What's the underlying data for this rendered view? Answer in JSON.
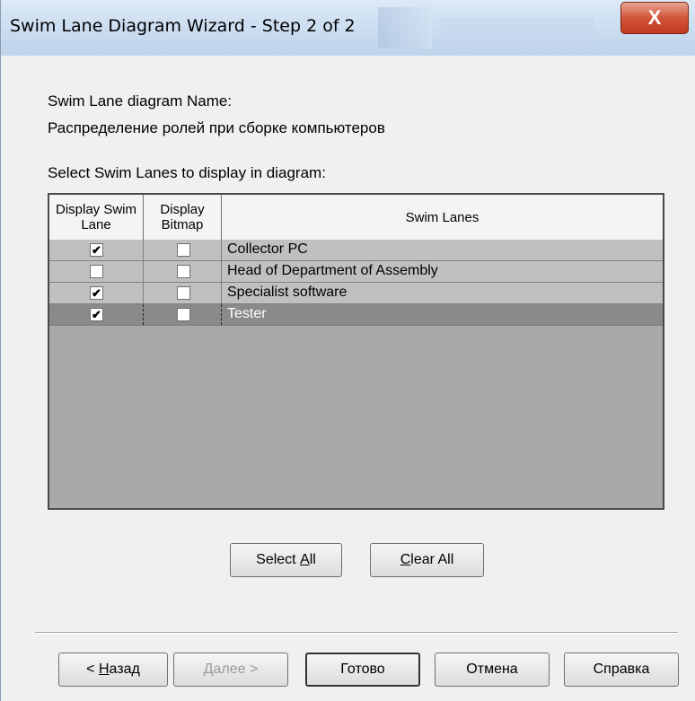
{
  "window": {
    "title": "Swim Lane Diagram Wizard - Step 2 of 2",
    "close_glyph": "X"
  },
  "form": {
    "name_label": "Swim Lane diagram Name:",
    "name_value": "Распределение ролей при сборке компьютеров",
    "select_label": "Select Swim Lanes to display in diagram:"
  },
  "grid": {
    "headers": {
      "display_swim_lane": "Display Swim Lane",
      "display_bitmap": "Display Bitmap",
      "swim_lanes": "Swim Lanes"
    },
    "rows": [
      {
        "name": "Collector PC",
        "display": true,
        "bitmap": false,
        "selected": false
      },
      {
        "name": "Head of Department of Assembly",
        "display": false,
        "bitmap": false,
        "selected": false
      },
      {
        "name": "Specialist software",
        "display": true,
        "bitmap": false,
        "selected": false
      },
      {
        "name": "Tester",
        "display": true,
        "bitmap": false,
        "selected": true
      }
    ]
  },
  "buttons": {
    "select_all_pre": "Select ",
    "select_all_mnemonic": "A",
    "select_all_post": "ll",
    "clear_all_mnemonic": "C",
    "clear_all_post": "lear All",
    "back_pre": "< ",
    "back_mnemonic": "Н",
    "back_post": "азад",
    "next_mnemonic": "Д",
    "next_post": "алее >",
    "finish": "Готово",
    "cancel": "Отмена",
    "help": "Справка"
  },
  "colors": {
    "grid_background": "#a9a9a9",
    "row_background": "#c0c0c0",
    "selected_row": "#8a8a8a",
    "close_button": "#d2543a"
  },
  "icons": {
    "checkbox_checked": "✔",
    "close": "close-icon"
  }
}
